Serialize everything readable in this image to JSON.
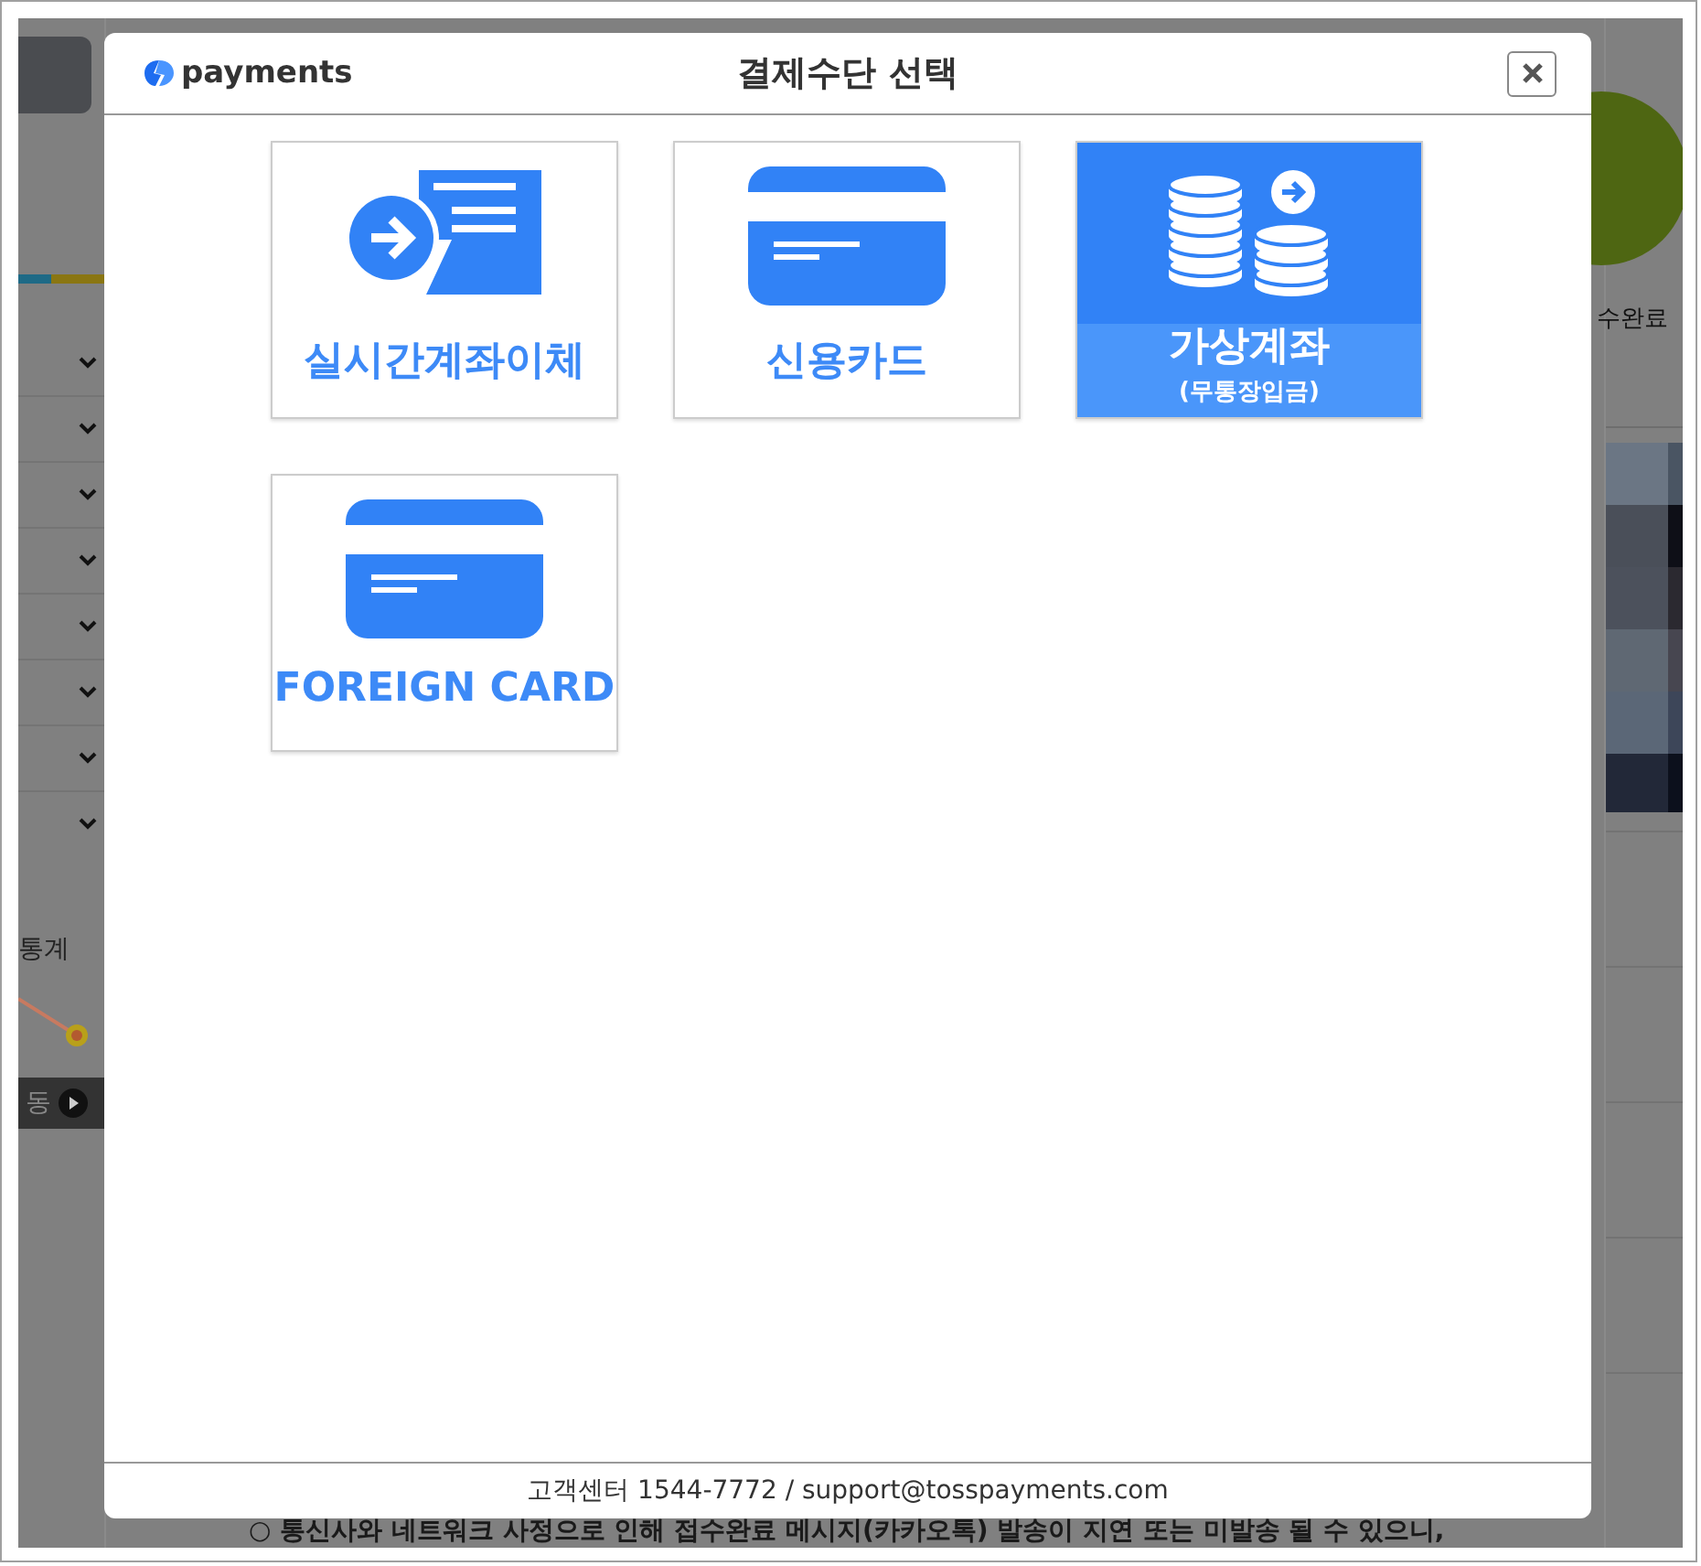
{
  "background": {
    "stats_label": "통계",
    "stats_button": "동",
    "status_label": "수완료",
    "notice": "○ 통신사와 네트워크 사정으로 인해 접수완료 메시지(카카오톡) 발송이 지연 또는 미발송 될 수 있으니,"
  },
  "dialog": {
    "logo": "payments",
    "title": "결제수단 선택",
    "methods": [
      {
        "kind": "transfer",
        "label": "실시간계좌이체",
        "selected": false
      },
      {
        "kind": "card",
        "label": "신용카드",
        "selected": false
      },
      {
        "kind": "virtual_account",
        "label": "가상계좌",
        "sublabel": "(무통장입금)",
        "selected": true
      },
      {
        "kind": "card",
        "label": "FOREIGN CARD",
        "selected": false
      }
    ],
    "footer": "고객센터 1544-7772 / support@tosspayments.com"
  }
}
